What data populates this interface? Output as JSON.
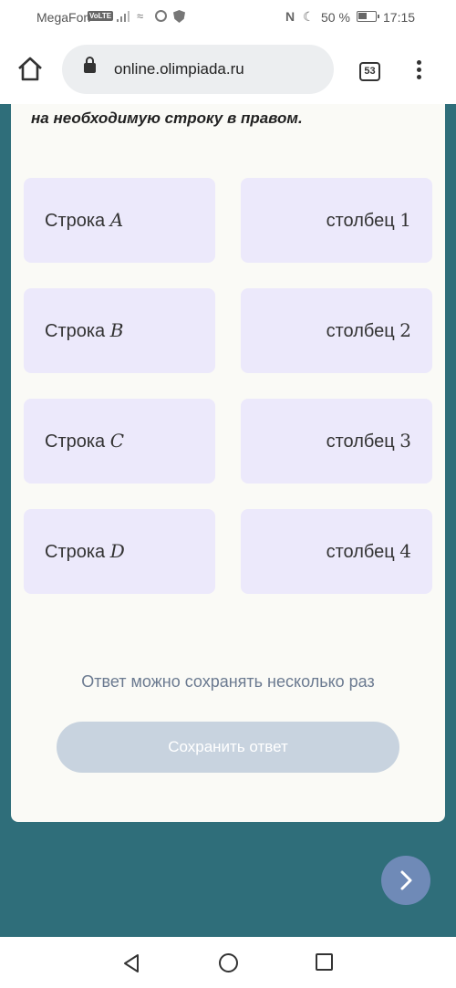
{
  "status_bar": {
    "carrier": "MegaFon",
    "volte": "VoLTE",
    "battery": "50 %",
    "time": "17:15"
  },
  "browser": {
    "url": "online.olimpiada.ru",
    "tabs_count": "53"
  },
  "question": {
    "text_tail": "на необходимую строку в правом."
  },
  "left_options": [
    {
      "label": "Строка",
      "var": "A"
    },
    {
      "label": "Строка",
      "var": "B"
    },
    {
      "label": "Строка",
      "var": "C"
    },
    {
      "label": "Строка",
      "var": "D"
    }
  ],
  "right_options": [
    {
      "label": "столбец",
      "num": "1"
    },
    {
      "label": "столбец",
      "num": "2"
    },
    {
      "label": "столбец",
      "num": "3"
    },
    {
      "label": "столбец",
      "num": "4"
    }
  ],
  "hint": "Ответ можно сохранять несколько раз",
  "save_button": "Сохранить ответ",
  "colors": {
    "background": "#2f6e7a",
    "option_bg": "#ece9fb",
    "save_disabled": "#c8d3df",
    "next_button": "#6f8ab7"
  }
}
